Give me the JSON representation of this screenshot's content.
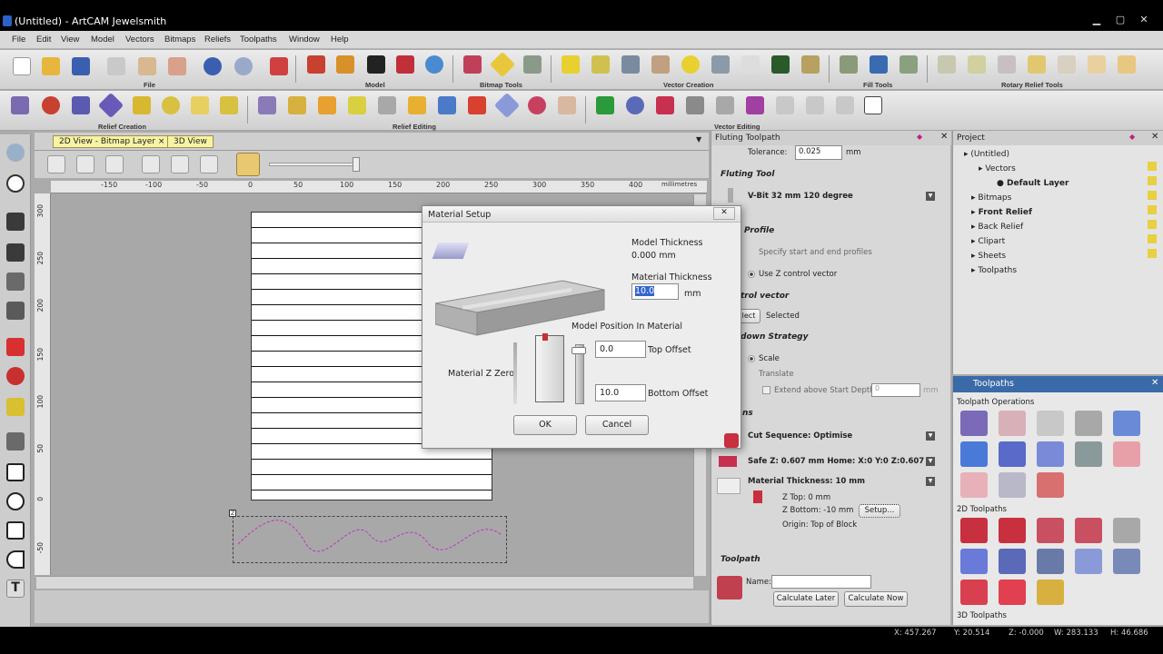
{
  "window": {
    "title": "(Untitled) - ArtCAM Jewelsmith"
  },
  "menu": [
    "File",
    "Edit",
    "View",
    "Model",
    "Vectors",
    "Bitmaps",
    "Reliefs",
    "Toolpaths",
    "Window",
    "Help"
  ],
  "toolbar_groups": {
    "file": "File",
    "model": "Model",
    "bitmap_tools": "Bitmap Tools",
    "vector_creation": "Vector Creation",
    "fill_tools": "Fill Tools",
    "rotary_relief_tools": "Rotary Relief Tools",
    "relief_creation": "Relief Creation",
    "relief_editing": "Relief Editing",
    "vector_editing": "Vector Editing"
  },
  "view_tabs": {
    "tab_2d": "2D View - Bitmap Layer",
    "tab_3d": "3D View",
    "close": "×"
  },
  "ruler": {
    "h_ticks": [
      "-150",
      "-100",
      "-50",
      "0",
      "50",
      "100",
      "150",
      "200",
      "250",
      "300",
      "350",
      "400"
    ],
    "unit": "millimetres",
    "v_ticks": [
      "300",
      "250",
      "200",
      "150",
      "100",
      "50",
      "0",
      "-50"
    ]
  },
  "dialog": {
    "title": "Material Setup",
    "model_thickness_label": "Model Thickness",
    "model_thickness_value": "0.000 mm",
    "material_thickness_label": "Material Thickness",
    "material_thickness_value": "10.0",
    "unit_mm": "mm",
    "model_position_label": "Model Position In Material",
    "z_zero_label": "Material Z Zero",
    "top_offset_value": "0.0",
    "top_offset_label": "Top Offset",
    "bottom_offset_value": "10.0",
    "bottom_offset_label": "Bottom Offset",
    "ok": "OK",
    "cancel": "Cancel"
  },
  "fluting_panel": {
    "title": "Fluting Toolpath",
    "tolerance_label": "Tolerance:",
    "tolerance_value": "0.025",
    "tolerance_unit": "mm",
    "section_fluting_tool": "Fluting Tool",
    "tool_name": "V-Bit 32 mm 120 degree",
    "section_profile": "Profile",
    "opt_specify": "Specify start and end profiles",
    "opt_z_control": "Use Z control vector",
    "section_control_vector": "trol vector",
    "select_btn": "lect",
    "selected_text": "Selected",
    "section_strategy": "down Strategy",
    "opt_scale": "Scale",
    "opt_translate": "Translate",
    "extend_label": "Extend above Start Depth",
    "extend_value": "0",
    "extend_unit": "mm",
    "section_ns": "ns",
    "cut_sequence": "Cut Sequence: Optimise",
    "safe_z": "Safe Z: 0.607 mm Home: X:0 Y:0 Z:0.607",
    "material_thickness": "Material Thickness: 10 mm",
    "z_top": "Z Top:   0  mm",
    "z_bottom": "Z Bottom: -10 mm",
    "origin": "Origin: Top of Block",
    "setup_btn": "Setup...",
    "section_toolpath": "Toolpath",
    "name_label": "Name:",
    "calc_later": "Calculate Later",
    "calc_now": "Calculate Now"
  },
  "project_panel": {
    "title": "Project",
    "tree": [
      "(Untitled)",
      "Vectors",
      "Default Layer",
      "Bitmaps",
      "Front Relief",
      "Back Relief",
      "Clipart",
      "Sheets",
      "Toolpaths"
    ]
  },
  "toolpaths_panel": {
    "title": "Toolpaths",
    "ops_label": "Toolpath Operations",
    "label_2d": "2D Toolpaths",
    "label_3d": "3D Toolpaths"
  },
  "status": {
    "x": "X: 457.267",
    "y": "Y: 20.514",
    "z": "Z: -0.000",
    "w": "W: 283.133",
    "h": "H: 46.686"
  },
  "colors": {
    "dialog_highlight": "#3366cc",
    "toolpath_red": "#c8283c",
    "panel_bg": "#d8d8d8"
  }
}
